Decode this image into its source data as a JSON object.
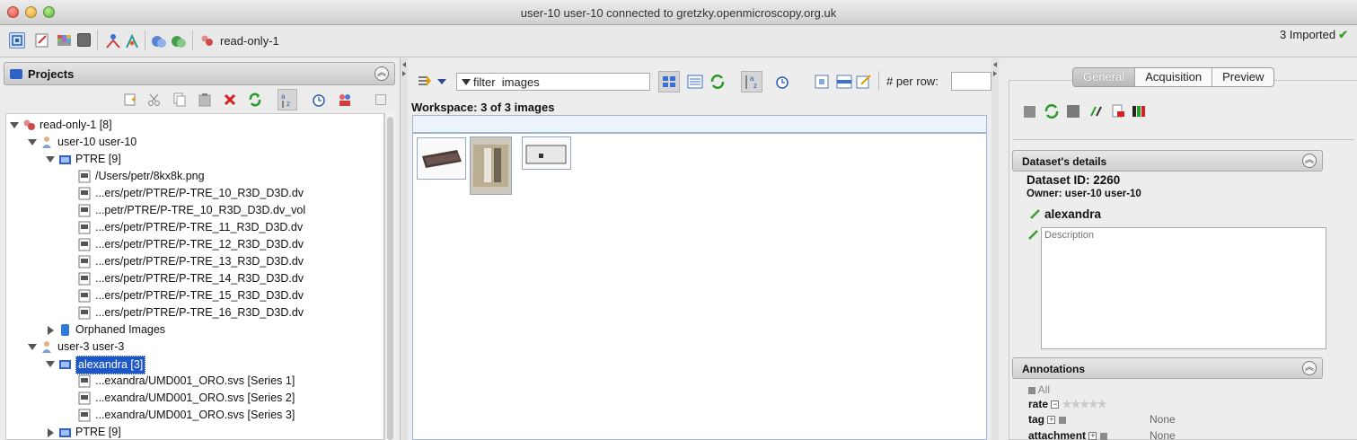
{
  "window": {
    "title": "user-10 user-10 connected to gretzky.openmicroscopy.org.uk"
  },
  "toolbar": {
    "group_label": "read-only-1",
    "import_status": "3 Imported"
  },
  "projects_panel": {
    "title": "Projects",
    "tree": [
      {
        "level": 0,
        "label": "read-only-1 [8]",
        "expanded": true,
        "icon": "group-icon"
      },
      {
        "level": 1,
        "label": "user-10 user-10",
        "expanded": true,
        "icon": "user-icon"
      },
      {
        "level": 2,
        "label": "PTRE [9]",
        "expanded": true,
        "icon": "dataset-icon"
      },
      {
        "level": 3,
        "label": "/Users/petr/8kx8k.png",
        "icon": "image-icon"
      },
      {
        "level": 3,
        "label": "...ers/petr/PTRE/P-TRE_10_R3D_D3D.dv",
        "icon": "image-icon"
      },
      {
        "level": 3,
        "label": "...petr/PTRE/P-TRE_10_R3D_D3D.dv_vol",
        "icon": "image-icon"
      },
      {
        "level": 3,
        "label": "...ers/petr/PTRE/P-TRE_11_R3D_D3D.dv",
        "icon": "image-icon"
      },
      {
        "level": 3,
        "label": "...ers/petr/PTRE/P-TRE_12_R3D_D3D.dv",
        "icon": "image-icon"
      },
      {
        "level": 3,
        "label": "...ers/petr/PTRE/P-TRE_13_R3D_D3D.dv",
        "icon": "image-icon"
      },
      {
        "level": 3,
        "label": "...ers/petr/PTRE/P-TRE_14_R3D_D3D.dv",
        "icon": "image-icon"
      },
      {
        "level": 3,
        "label": "...ers/petr/PTRE/P-TRE_15_R3D_D3D.dv",
        "icon": "image-icon"
      },
      {
        "level": 3,
        "label": "...ers/petr/PTRE/P-TRE_16_R3D_D3D.dv",
        "icon": "image-icon"
      },
      {
        "level": 2,
        "label": "Orphaned Images",
        "expanded": false,
        "icon": "orphaned-icon"
      },
      {
        "level": 1,
        "label": "user-3 user-3",
        "expanded": true,
        "icon": "user-icon"
      },
      {
        "level": 2,
        "label": "alexandra [3]",
        "expanded": true,
        "icon": "dataset-icon",
        "selected": true
      },
      {
        "level": 3,
        "label": "...exandra/UMD001_ORO.svs [Series 1]",
        "icon": "image-icon"
      },
      {
        "level": 3,
        "label": "...exandra/UMD001_ORO.svs [Series 2]",
        "icon": "image-icon"
      },
      {
        "level": 3,
        "label": "...exandra/UMD001_ORO.svs [Series 3]",
        "icon": "image-icon"
      },
      {
        "level": 2,
        "label": "PTRE [9]",
        "expanded": false,
        "icon": "dataset-icon"
      }
    ]
  },
  "center": {
    "filter_value": "filter  images",
    "per_row_label": "# per row:",
    "per_row_value": "",
    "workspace_label": "Workspace: 3 of 3 images",
    "thumbnails": 3
  },
  "right": {
    "tabs": [
      {
        "label": "General",
        "active": true
      },
      {
        "label": "Acquisition",
        "active": false
      },
      {
        "label": "Preview",
        "active": false
      }
    ],
    "details_title": "Dataset's details",
    "dataset_id": "Dataset ID: 2260",
    "owner": "Owner: user-10 user-10",
    "name": "alexandra",
    "description_placeholder": "Description",
    "annotations_title": "Annotations",
    "all_label": "All",
    "rate_label": "rate",
    "tag_label": "tag",
    "tag_value": "None",
    "attachment_label": "attachment",
    "attachment_value": "None"
  },
  "colors": {
    "selection": "#1d56c7",
    "imported_check": "#3aa02e",
    "workspace_border": "#9fb6d4"
  }
}
